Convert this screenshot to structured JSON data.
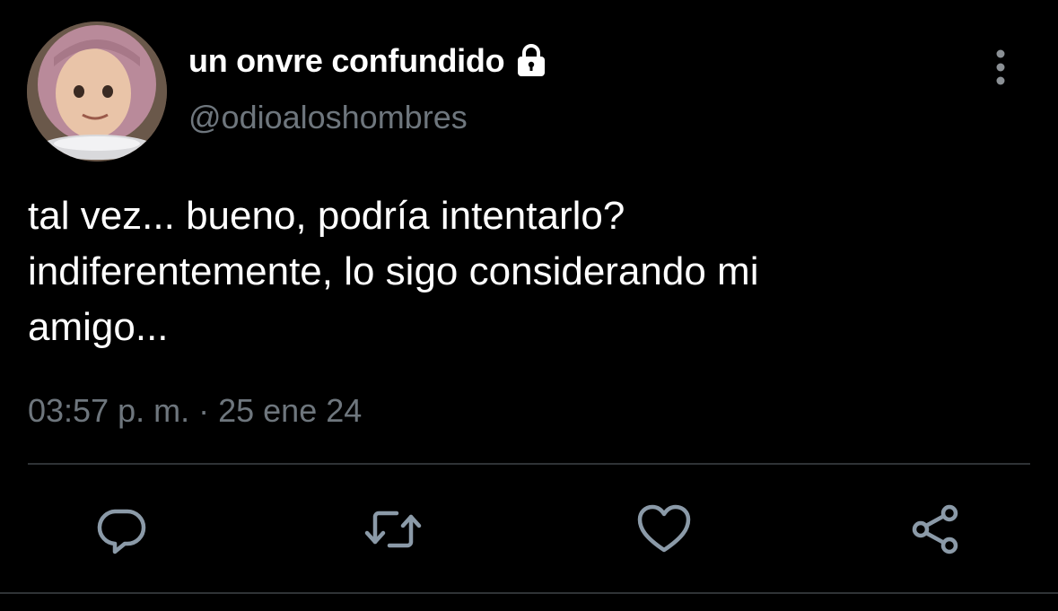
{
  "author": {
    "display_name": "un onvre confundido",
    "handle": "@odioaloshombres",
    "protected_icon": "lock-icon",
    "avatar": "avatar-image"
  },
  "tweet": {
    "lines": [
      "tal vez... bueno, podría intentarlo?",
      "indiferentemente, lo sigo considerando mi",
      "amigo..."
    ],
    "time": "03:57 p. m.",
    "separator": " · ",
    "date": "25 ene 24"
  },
  "actions": {
    "reply_icon": "reply-icon",
    "retweet_icon": "retweet-icon",
    "like_icon": "like-icon",
    "share_icon": "share-icon",
    "more_icon": "more-vertical-icon"
  },
  "colors": {
    "background": "#000000",
    "primary_text": "#ffffff",
    "secondary_text": "#6e767d",
    "divider": "#2f3336"
  }
}
